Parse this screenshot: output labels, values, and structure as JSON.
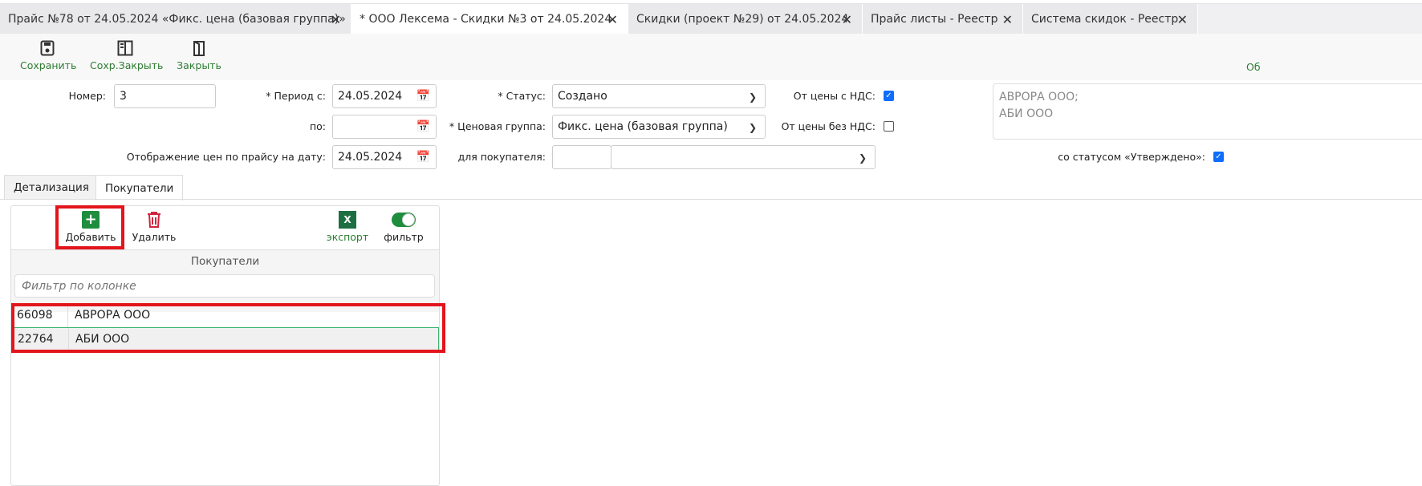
{
  "tabs": [
    {
      "label": "Прайс №78 от 24.05.2024 «Фикс. цена (базовая группа)»",
      "active": false
    },
    {
      "label": "* ООО Лексема - Скидки №3 от 24.05.2024",
      "active": true
    },
    {
      "label": "Скидки (проект №29) от 24.05.2024",
      "active": false
    },
    {
      "label": "Прайс листы - Реестр",
      "active": false
    },
    {
      "label": "Система скидок - Реестр",
      "active": false
    }
  ],
  "toolbar": {
    "save": "Сохранить",
    "save_close": "Сохр.Закрыть",
    "close": "Закрыть",
    "right_cut": "Об"
  },
  "form": {
    "number_label": "Номер:",
    "number": "3",
    "period_from_label": "* Период с:",
    "period_from": "24.05.2024",
    "period_to_label": "по:",
    "period_to": "",
    "display_label": "Отображение цен по прайсу на дату:",
    "display_date": "24.05.2024",
    "status_label": "* Статус:",
    "status": "Создано",
    "price_group_label": "* Ценовая группа:",
    "price_group": "Фикс. цена (базовая группа)",
    "buyer_label": "для покупателя:",
    "buyer_code": "",
    "buyer": "",
    "vat_incl_label": "От цены с НДС:",
    "vat_incl": true,
    "vat_excl_label": "От цены без НДС:",
    "vat_excl": false,
    "approved_label": "со статусом «Утверждено»:",
    "approved": true,
    "buyers_text_line1": "АВРОРА ООО;",
    "buyers_text_line2": "АБИ ООО"
  },
  "subtabs": [
    {
      "label": "Детализация",
      "active": false
    },
    {
      "label": "Покупатели",
      "active": true
    }
  ],
  "grid": {
    "add": "Добавить",
    "delete": "Удалить",
    "export": "экспорт",
    "filter": "фильтр",
    "filter_on": true,
    "column_header": "Покупатели",
    "filter_placeholder": "Фильтр по колонке",
    "rows": [
      {
        "code": "66098",
        "name": "АВРОРА ООО"
      },
      {
        "code": "22764",
        "name": "АБИ ООО"
      }
    ]
  },
  "colors": {
    "accent_green": "#2e7d32",
    "highlight_red": "#e3141b",
    "checkbox_blue": "#0d6efd"
  }
}
